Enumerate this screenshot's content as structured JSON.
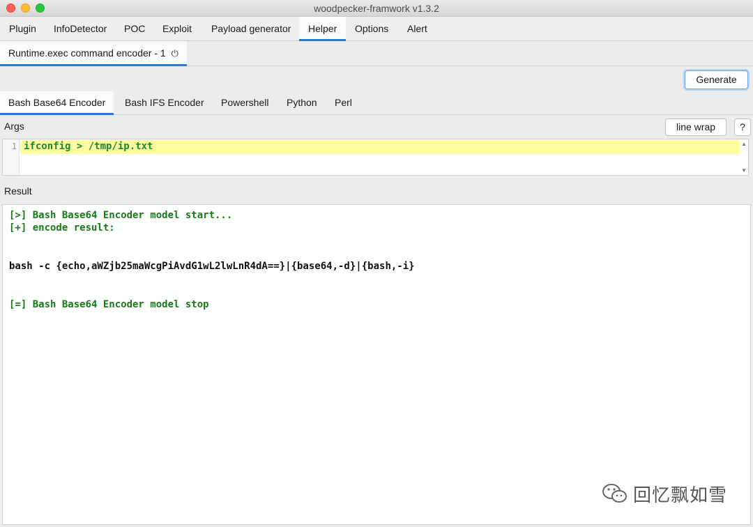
{
  "window": {
    "title": "woodpecker-framwork v1.3.2"
  },
  "menubar": {
    "items": [
      {
        "label": "Plugin"
      },
      {
        "label": "InfoDetector"
      },
      {
        "label": "POC"
      },
      {
        "label": "Exploit"
      },
      {
        "label": "Payload generator"
      },
      {
        "label": "Helper",
        "active": true
      },
      {
        "label": "Options"
      },
      {
        "label": "Alert"
      }
    ]
  },
  "subtab": {
    "label": "Runtime.exec command encoder - 1",
    "icon": "power-icon"
  },
  "toolbar": {
    "generate_label": "Generate"
  },
  "encoder_tabs": [
    {
      "label": "Bash Base64 Encoder",
      "active": true
    },
    {
      "label": "Bash IFS Encoder"
    },
    {
      "label": "Powershell"
    },
    {
      "label": "Python"
    },
    {
      "label": "Perl"
    }
  ],
  "args": {
    "label": "Args",
    "line_wrap_label": "line wrap",
    "help_label": "?",
    "line_number": "1",
    "code": "ifconfig > /tmp/ip.txt"
  },
  "result": {
    "label": "Result",
    "lines": [
      {
        "text": "[>] Bash Base64 Encoder model start...",
        "color": "green"
      },
      {
        "text": "[+] encode result:",
        "color": "green"
      },
      {
        "text": "",
        "color": "black"
      },
      {
        "text": "",
        "color": "black"
      },
      {
        "text": "bash -c {echo,aWZjb25maWcgPiAvdG1wL2lwLnR4dA==}|{base64,-d}|{bash,-i}",
        "color": "black"
      },
      {
        "text": "",
        "color": "black"
      },
      {
        "text": "",
        "color": "black"
      },
      {
        "text": "[=] Bash Base64 Encoder model stop",
        "color": "green"
      }
    ]
  },
  "watermark": {
    "text": "回忆飘如雪",
    "icon": "wechat-icon"
  },
  "colors": {
    "accent": "#2b7ad0",
    "result_green": "#1a7a1a",
    "code_green": "#1a8c2e",
    "line_highlight": "#fdfda0"
  }
}
